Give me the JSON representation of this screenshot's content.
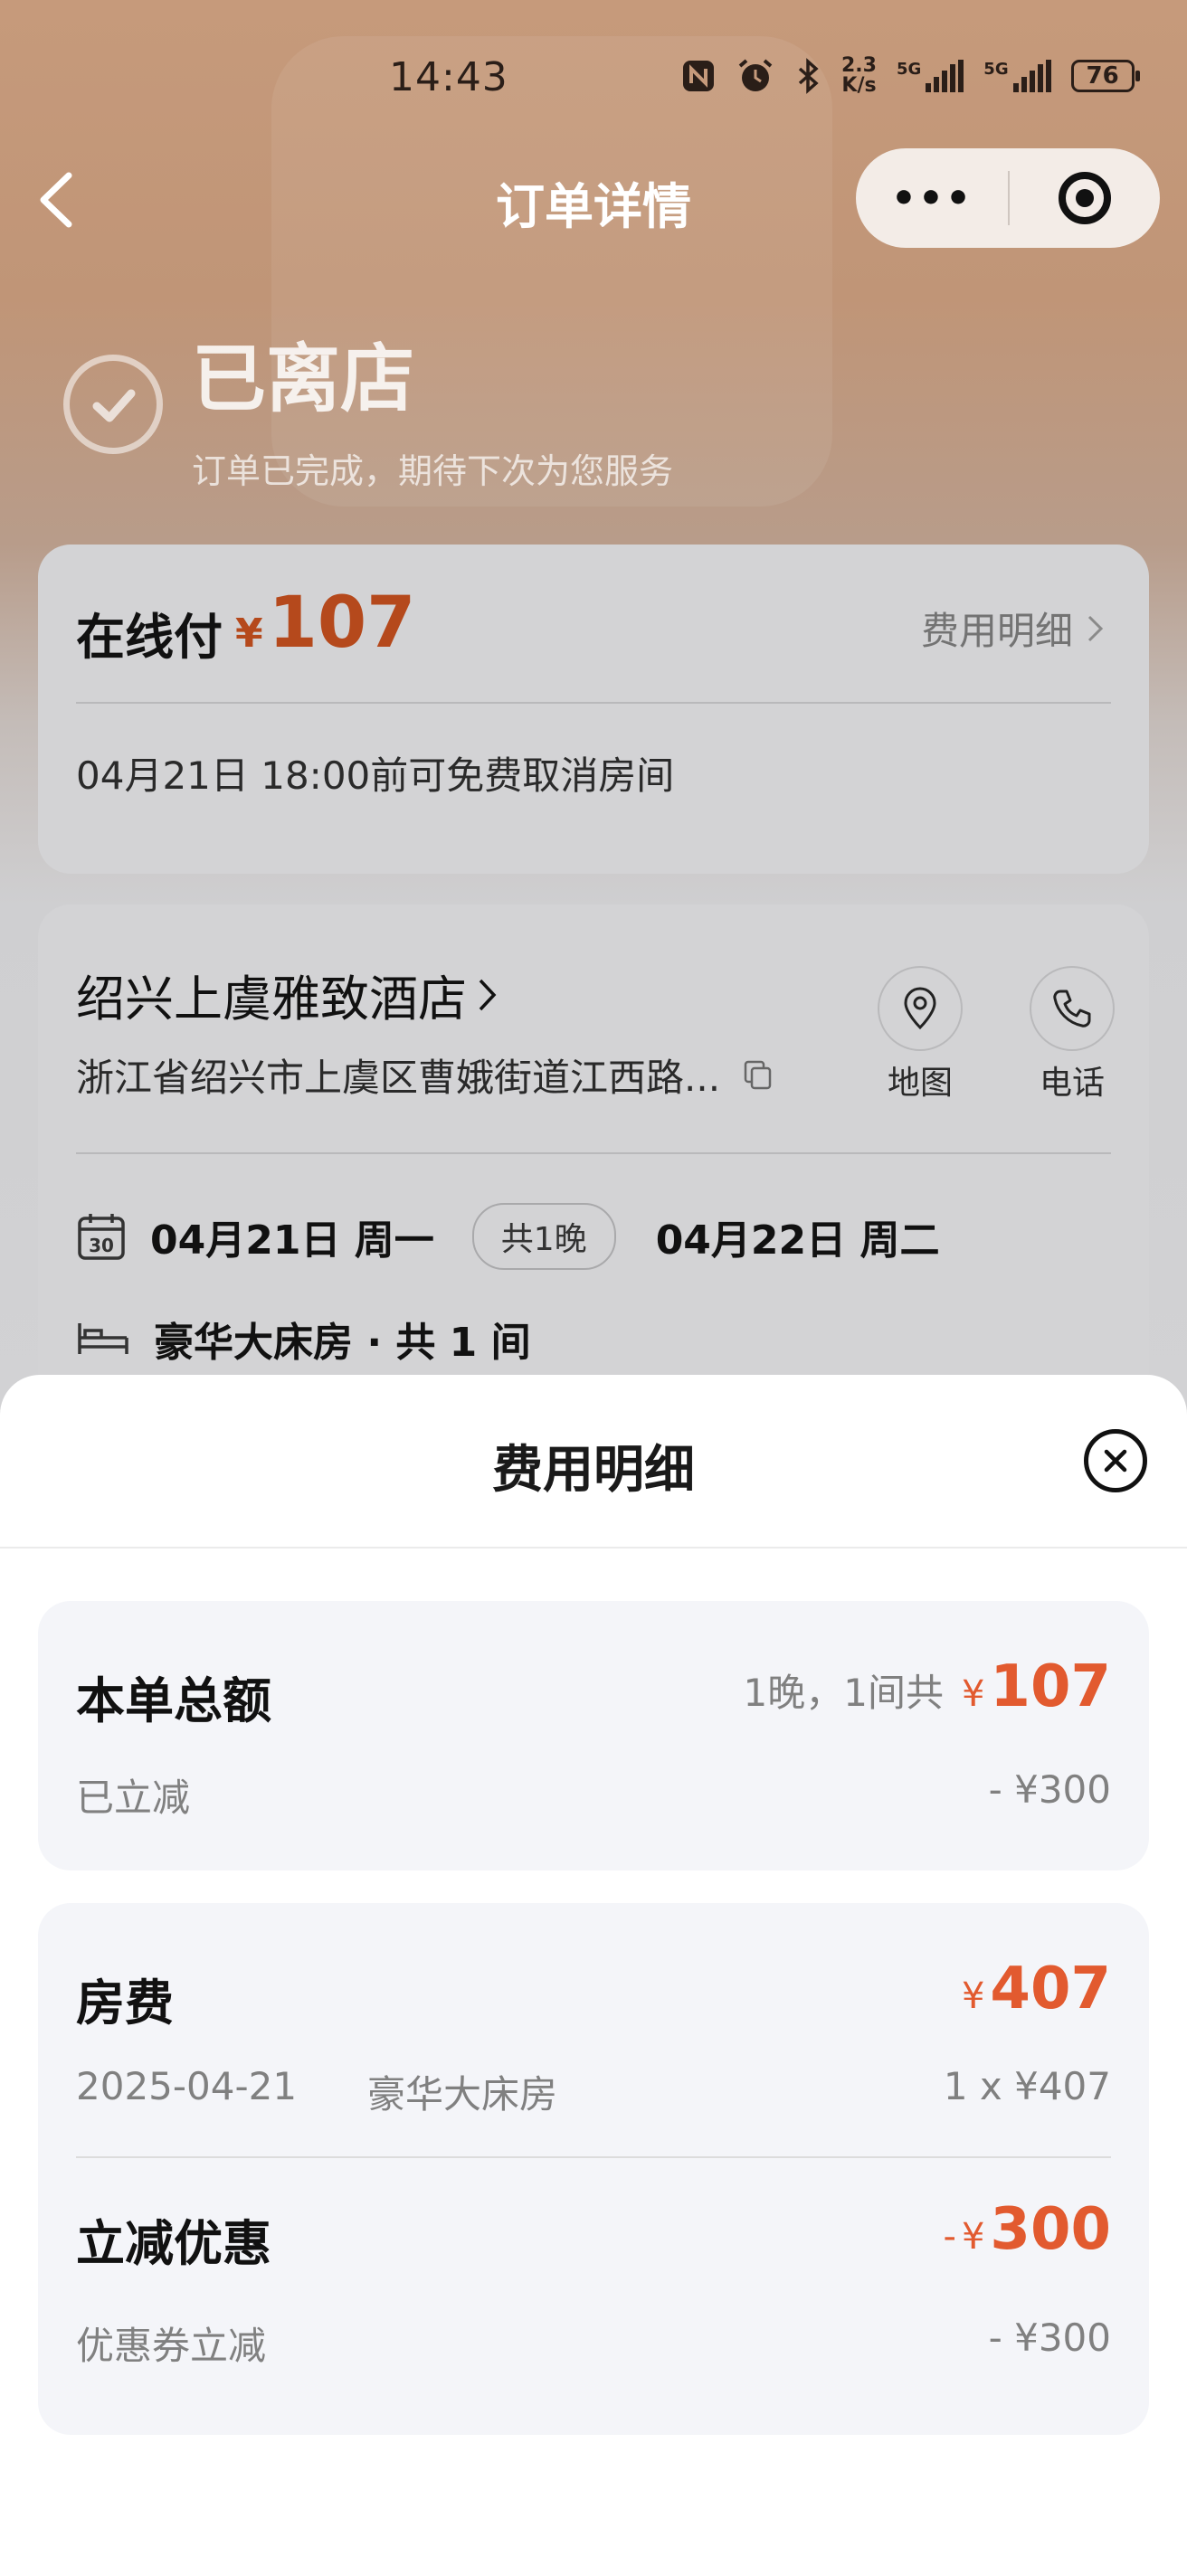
{
  "status_bar": {
    "time": "14:43",
    "net_speed_value": "2.3",
    "net_speed_unit": "K/s",
    "signal_label": "5G",
    "battery": "76",
    "icons": [
      "nfc-icon",
      "alarm-icon",
      "bluetooth-icon",
      "signal-icon",
      "signal-icon",
      "battery-icon"
    ]
  },
  "nav": {
    "title": "订单详情",
    "more_label": "•••"
  },
  "order_status": {
    "title": "已离店",
    "subtitle": "订单已完成，期待下次为您服务"
  },
  "payment": {
    "label": "在线付",
    "currency": "¥",
    "amount": "107",
    "fee_detail_link": "费用明细",
    "cancel_policy": "04月21日 18:00前可免费取消房间"
  },
  "hotel": {
    "name": "绍兴上虞雅致酒店",
    "address": "浙江省绍兴市上虞区曹娥街道江西路...",
    "map_label": "地图",
    "phone_label": "电话",
    "checkin": "04月21日 周一",
    "nights": "共1晚",
    "checkout": "04月22日 周二",
    "room": "豪华大床房 · 共 1 间"
  },
  "fee_sheet": {
    "title": "费用明细",
    "total": {
      "label": "本单总额",
      "desc": "1晚，1间共",
      "currency": "¥",
      "amount": "107",
      "discount_label": "已立减",
      "discount_value": "- ¥300"
    },
    "room_fee": {
      "label": "房费",
      "currency": "¥",
      "amount": "407",
      "date": "2025-04-21",
      "room_type": "豪华大床房",
      "calc": "1 x ¥407"
    },
    "discount": {
      "label": "立减优惠",
      "prefix": "-",
      "currency": "¥",
      "amount": "300",
      "sub_label": "优惠券立减",
      "sub_value": "- ¥300"
    }
  },
  "colors": {
    "accent_price": "#e25a2f",
    "header_bg": "#c69a7b",
    "panel_bg": "#f4f5f9"
  }
}
